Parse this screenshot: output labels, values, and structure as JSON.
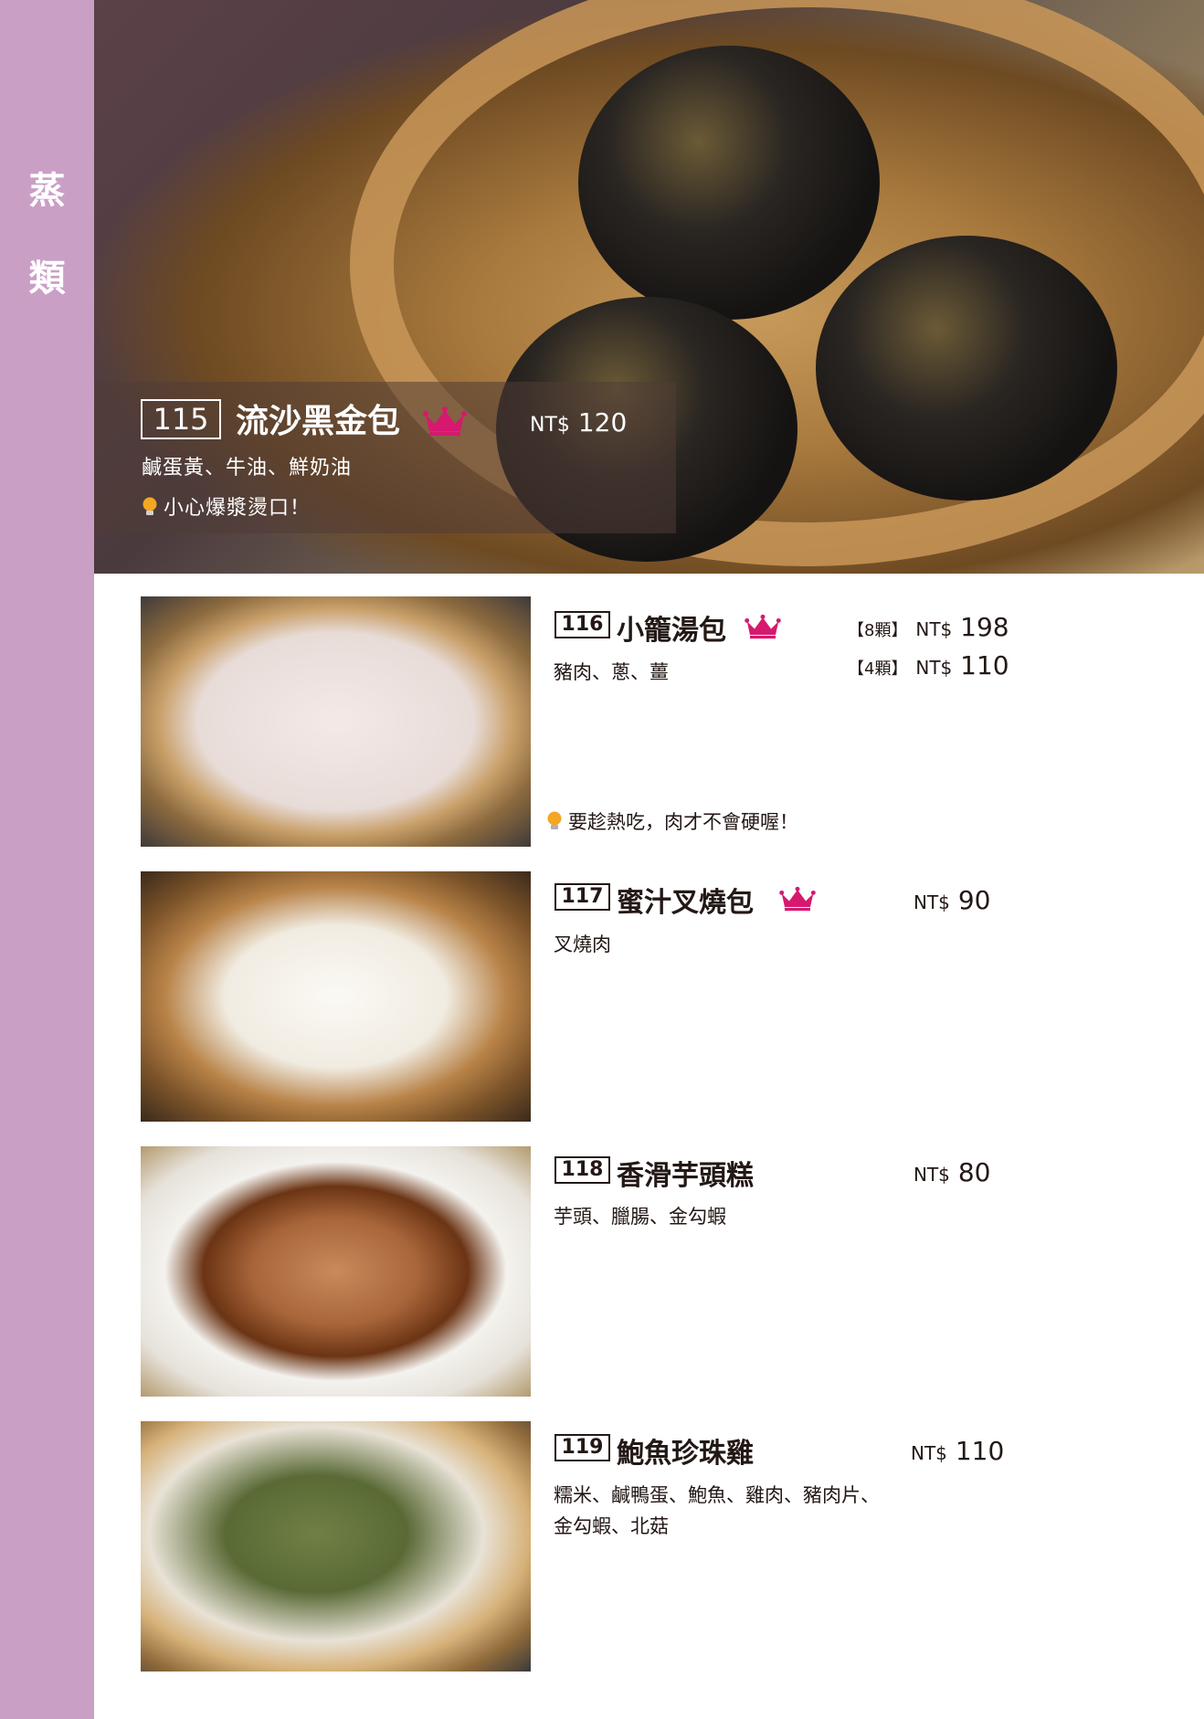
{
  "category": {
    "char1": "蒸",
    "char2": "類"
  },
  "featured": {
    "number": "115",
    "name": "流沙黑金包",
    "currency": "NT$",
    "price": "120",
    "description": "鹹蛋黃、牛油、鮮奶油",
    "tip": "小心爆漿燙口！"
  },
  "items": [
    {
      "number": "116",
      "name": "小籠湯包",
      "crown": true,
      "prices": [
        {
          "qty": "【8顆】",
          "currency": "NT$",
          "price": "198"
        },
        {
          "qty": "【4顆】",
          "currency": "NT$",
          "price": "110"
        }
      ],
      "description": "豬肉、蔥、薑",
      "tip": "要趁熱吃，肉才不會硬喔！"
    },
    {
      "number": "117",
      "name": "蜜汁叉燒包",
      "crown": true,
      "currency": "NT$",
      "price": "90",
      "description": "叉燒肉"
    },
    {
      "number": "118",
      "name": "香滑芋頭糕",
      "crown": false,
      "currency": "NT$",
      "price": "80",
      "description": "芋頭、臘腸、金勾蝦"
    },
    {
      "number": "119",
      "name": "鮑魚珍珠雞",
      "crown": false,
      "currency": "NT$",
      "price": "110",
      "description_line1": "糯米、鹹鴨蛋、鮑魚、雞肉、豬肉片、",
      "description_line2": "金勾蝦、北菇"
    }
  ],
  "colors": {
    "sidebar": "#c99fc6",
    "crown": "#d6196e",
    "text": "#231815"
  },
  "icons": [
    "crown-icon",
    "lightbulb-icon"
  ]
}
